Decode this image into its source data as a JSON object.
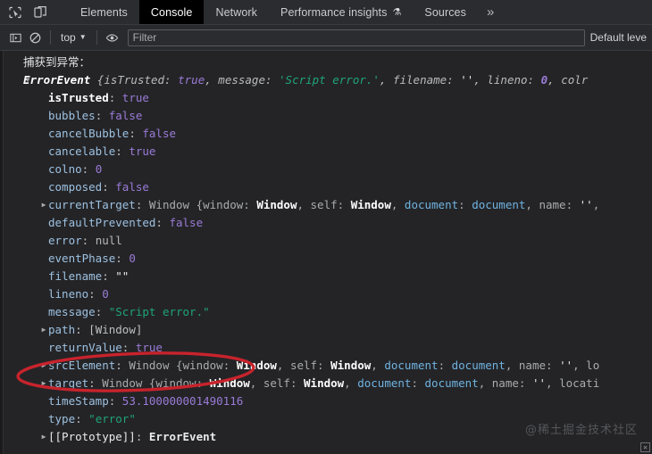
{
  "devtools": {
    "toolbar_icons": [
      {
        "name": "inspect-element-icon",
        "title": "Inspect element"
      },
      {
        "name": "device-toolbar-icon",
        "title": "Toggle device toolbar"
      }
    ],
    "tabs": [
      {
        "label": "Elements",
        "active": false,
        "icon": ""
      },
      {
        "label": "Console",
        "active": true,
        "icon": ""
      },
      {
        "label": "Network",
        "active": false,
        "icon": ""
      },
      {
        "label": "Performance insights",
        "active": false,
        "icon": "flask-icon",
        "icon_glyph": "⚗"
      },
      {
        "label": "Sources",
        "active": false,
        "icon": ""
      }
    ],
    "more_tabs_label": "»"
  },
  "console_toolbar": {
    "sidebar_toggle": "console-sidebar-icon",
    "clear_console": "clear-console-icon",
    "context_value": "top",
    "caret": "▼",
    "eye_icon": "live-expression-icon",
    "filter_placeholder": "Filter",
    "filter_value": "",
    "levels_label": "Default leve"
  },
  "console_output": {
    "intro_line": "捕获到异常：",
    "header": {
      "arrow": "▼",
      "name": "ErrorEvent",
      "open_brace": "{",
      "preview": [
        {
          "key": "isTrusted",
          "sep": ": ",
          "value": "true",
          "type": "bool",
          "after": ", "
        },
        {
          "key": "message",
          "sep": ": ",
          "value": "'Script error.'",
          "type": "str",
          "after": ", "
        },
        {
          "key": "filename",
          "sep": ": ",
          "value": "''",
          "type": "strw",
          "after": ", "
        },
        {
          "key": "lineno",
          "sep": ": ",
          "value": "0",
          "type": "num",
          "after": ", "
        },
        {
          "key": "colr",
          "sep": "",
          "value": "",
          "type": "plain",
          "after": ""
        }
      ]
    },
    "properties": [
      {
        "arrow": "",
        "key": "isTrusted",
        "key_style": "own",
        "value": "true",
        "value_style": "bool"
      },
      {
        "arrow": "",
        "key": "bubbles",
        "key_style": "proto",
        "value": "false",
        "value_style": "bool"
      },
      {
        "arrow": "",
        "key": "cancelBubble",
        "key_style": "proto",
        "value": "false",
        "value_style": "bool"
      },
      {
        "arrow": "",
        "key": "cancelable",
        "key_style": "proto",
        "value": "true",
        "value_style": "bool"
      },
      {
        "arrow": "",
        "key": "colno",
        "key_style": "proto",
        "value": "0",
        "value_style": "num"
      },
      {
        "arrow": "",
        "key": "composed",
        "key_style": "proto",
        "value": "false",
        "value_style": "bool"
      },
      {
        "arrow": "▶",
        "key": "currentTarget",
        "key_style": "proto",
        "value": "WINDOW_PREVIEW_1",
        "value_style": "window"
      },
      {
        "arrow": "",
        "key": "defaultPrevented",
        "key_style": "proto",
        "value": "false",
        "value_style": "bool"
      },
      {
        "arrow": "",
        "key": "error",
        "key_style": "proto",
        "value": "null",
        "value_style": "null"
      },
      {
        "arrow": "",
        "key": "eventPhase",
        "key_style": "proto",
        "value": "0",
        "value_style": "num"
      },
      {
        "arrow": "",
        "key": "filename",
        "key_style": "proto",
        "value": "\"\"",
        "value_style": "strw"
      },
      {
        "arrow": "",
        "key": "lineno",
        "key_style": "proto",
        "value": "0",
        "value_style": "num"
      },
      {
        "arrow": "",
        "key": "message",
        "key_style": "proto",
        "value": "\"Script error.\"",
        "value_style": "str"
      },
      {
        "arrow": "▶",
        "key": "path",
        "key_style": "proto",
        "value": "[Window]",
        "value_style": "plain"
      },
      {
        "arrow": "",
        "key": "returnValue",
        "key_style": "proto",
        "value": "true",
        "value_style": "bool"
      },
      {
        "arrow": "▶",
        "key": "srcElement",
        "key_style": "proto",
        "value": "WINDOW_PREVIEW_2",
        "value_style": "window"
      },
      {
        "arrow": "▶",
        "key": "target",
        "key_style": "proto",
        "value": "WINDOW_PREVIEW_3",
        "value_style": "window"
      },
      {
        "arrow": "",
        "key": "timeStamp",
        "key_style": "proto",
        "value": "53.100000001490116",
        "value_style": "num"
      },
      {
        "arrow": "",
        "key": "type",
        "key_style": "proto",
        "value": "\"error\"",
        "value_style": "str"
      }
    ],
    "window_previews": {
      "WINDOW_PREVIEW_1": "Window {window: Window, self: Window, document: document, name: '',",
      "WINDOW_PREVIEW_2": "Window {window: Window, self: Window, document: document, name: '', lo",
      "WINDOW_PREVIEW_3": "Window {window: Window, self: Window, document: document, name: '', locati"
    },
    "prototype_row": {
      "arrow": "▶",
      "key": "[[Prototype]]",
      "value": "ErrorEvent"
    }
  },
  "annotation": {
    "shape": "red-ellipse",
    "color": "#c8232c",
    "targets_line": "message: \"Script error.\""
  },
  "watermark": {
    "text": "@稀土掘金技术社区"
  },
  "edge_glyph": {
    "text": "✕"
  },
  "colors": {
    "background": "#242427",
    "tabbar": "#2b2c2f",
    "toolbar": "#292a2d",
    "active_tab_bg": "#000000",
    "key_property": "#9dc1e0",
    "value_bool": "#9a7bd6",
    "value_string": "#1fa47a",
    "annotation_red": "#c8232c"
  }
}
